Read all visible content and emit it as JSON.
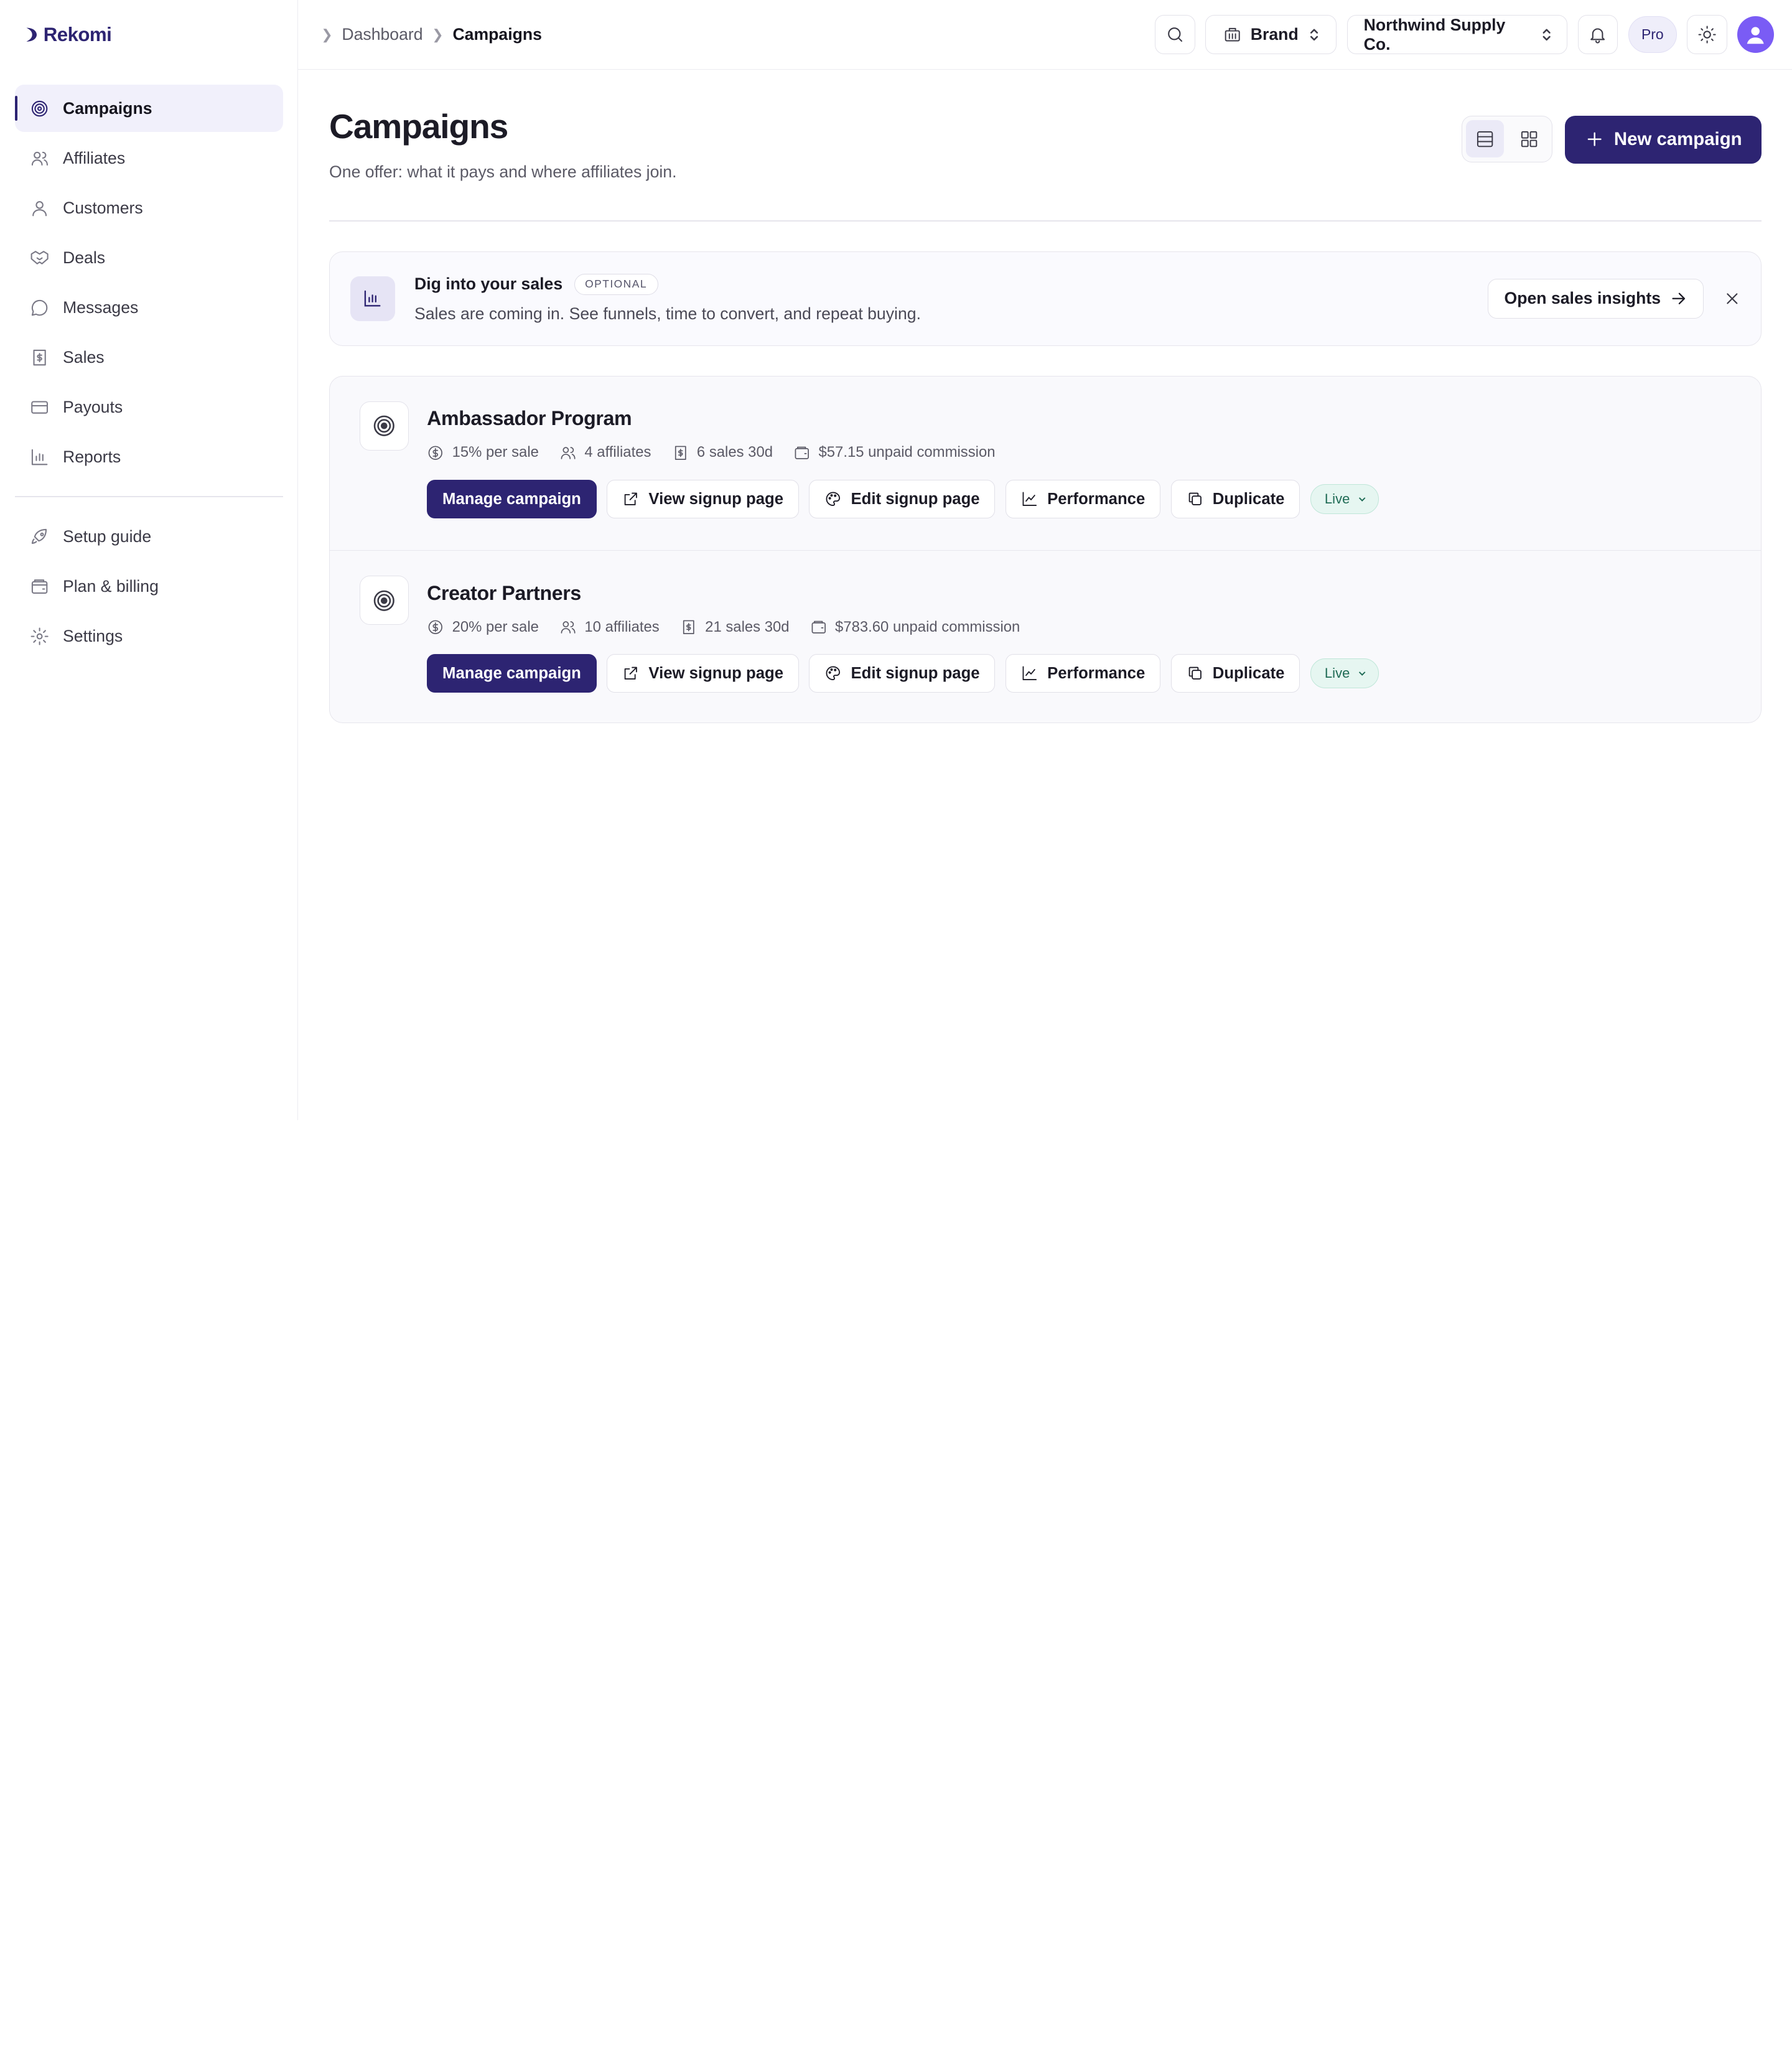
{
  "brand": {
    "name": "Rekomi"
  },
  "sidebar": {
    "items": [
      {
        "label": "Campaigns",
        "icon": "target-icon",
        "active": true
      },
      {
        "label": "Affiliates",
        "icon": "users-icon"
      },
      {
        "label": "Customers",
        "icon": "user-icon"
      },
      {
        "label": "Deals",
        "icon": "handshake-icon"
      },
      {
        "label": "Messages",
        "icon": "message-icon"
      },
      {
        "label": "Sales",
        "icon": "receipt-icon"
      },
      {
        "label": "Payouts",
        "icon": "credit-card-icon"
      },
      {
        "label": "Reports",
        "icon": "bar-chart-icon"
      }
    ],
    "secondary": [
      {
        "label": "Setup guide",
        "icon": "rocket-icon"
      },
      {
        "label": "Plan & billing",
        "icon": "wallet-icon"
      },
      {
        "label": "Settings",
        "icon": "gear-icon"
      }
    ]
  },
  "breadcrumb": {
    "parent": "Dashboard",
    "current": "Campaigns"
  },
  "topbar": {
    "role_select": "Brand",
    "workspace_select": "Northwind Supply Co.",
    "plan_badge": "Pro"
  },
  "page": {
    "title": "Campaigns",
    "subtitle": "One offer: what it pays and where affiliates join.",
    "new_button": "New campaign"
  },
  "banner": {
    "title": "Dig into your sales",
    "badge": "OPTIONAL",
    "description": "Sales are coming in. See funnels, time to convert, and repeat buying.",
    "button": "Open sales insights"
  },
  "actions": {
    "manage": "Manage campaign",
    "view_signup": "View signup page",
    "edit_signup": "Edit signup page",
    "performance": "Performance",
    "duplicate": "Duplicate"
  },
  "campaigns": [
    {
      "name": "Ambassador Program",
      "rate": "15% per sale",
      "affiliates": "4 affiliates",
      "sales": "6 sales 30d",
      "unpaid": "$57.15 unpaid commission",
      "status": "Live"
    },
    {
      "name": "Creator Partners",
      "rate": "20% per sale",
      "affiliates": "10 affiliates",
      "sales": "21 sales 30d",
      "unpaid": "$783.60 unpaid commission",
      "status": "Live"
    }
  ],
  "colors": {
    "accent": "#2d2472",
    "live_bg": "#e6f6f1",
    "avatar": "#7a5cf5"
  }
}
